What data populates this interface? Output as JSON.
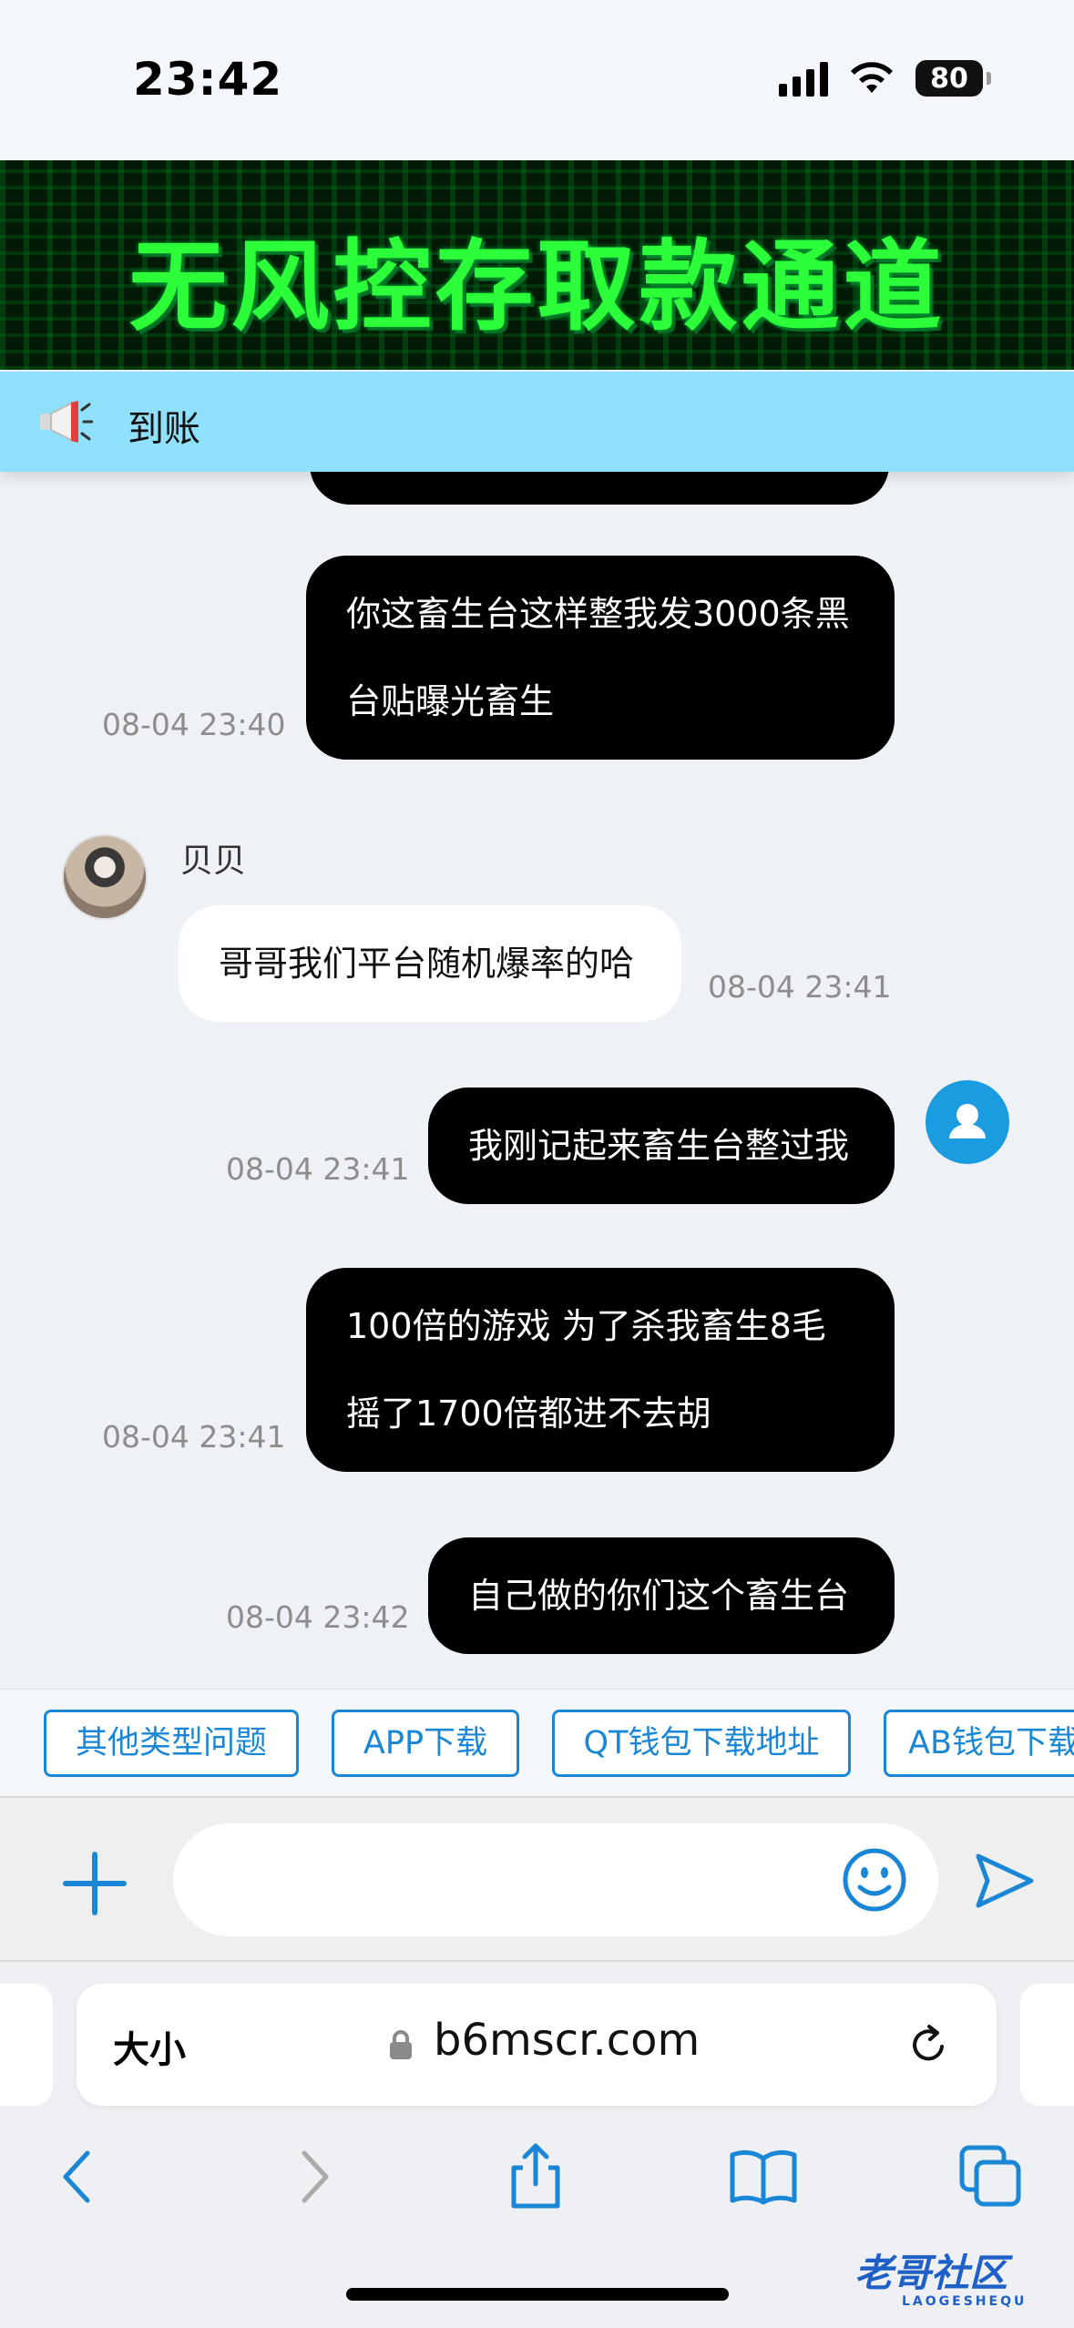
{
  "status_bar": {
    "time": "23:42",
    "battery": "80"
  },
  "banner": {
    "text": "无风控存取款通道"
  },
  "notice": {
    "text": "到账"
  },
  "chat": {
    "messages": [
      {
        "text_line1": "你这畜生台这样整我发3000条黑",
        "text_line2": "台贴曝光畜生",
        "time": "08-04 23:40",
        "direction": "out"
      },
      {
        "sender": "贝贝",
        "text": "哥哥我们平台随机爆率的哈",
        "time": "08-04 23:41",
        "direction": "in"
      },
      {
        "text": "我刚记起来畜生台整过我",
        "time": "08-04 23:41",
        "direction": "out"
      },
      {
        "text_line1": "100倍的游戏 为了杀我畜生8毛",
        "text_line2": "摇了1700倍都进不去胡",
        "time": "08-04 23:41",
        "direction": "out"
      },
      {
        "text": "自己做的你们这个畜生台",
        "time": "08-04 23:42",
        "direction": "out"
      }
    ]
  },
  "quick_replies": [
    "其他类型问题",
    "APP下载",
    "QT钱包下载地址",
    "AB钱包下载"
  ],
  "input": {
    "placeholder": ""
  },
  "browser": {
    "text_size": "大小",
    "domain": "b6mscr.com"
  },
  "watermark": {
    "text": "老哥社区",
    "sub": "LAOGESHEQU"
  },
  "colors": {
    "accent": "#1a87d6",
    "notice_bg": "#8fe0fb",
    "banner_text": "#2cff3a",
    "outgoing_bubble": "#000000"
  }
}
